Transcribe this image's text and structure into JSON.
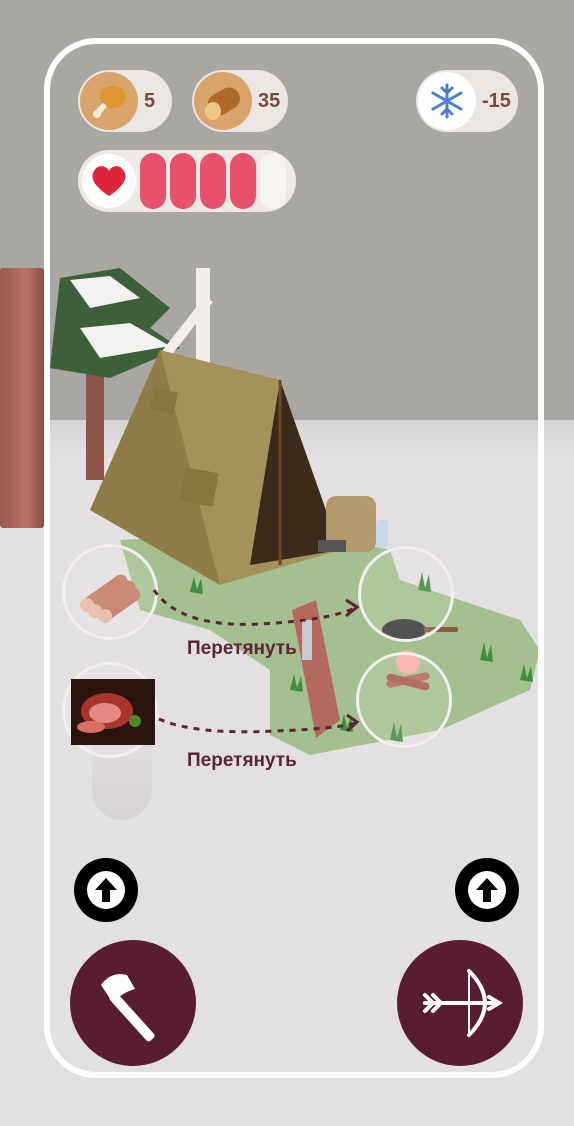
{
  "resources": {
    "food": {
      "icon": "drumstick-icon",
      "value": "5"
    },
    "wood": {
      "icon": "log-icon",
      "value": "35"
    },
    "temperature": {
      "icon": "snowflake-icon",
      "value": "-15"
    }
  },
  "health": {
    "icon": "heart-icon",
    "segments_total": 5,
    "segments_filled": 4,
    "color_on": "#e8506e"
  },
  "hints": {
    "logs": {
      "item_icon": "firewood-icon",
      "label": "Перетянуть",
      "target": "frying-pan"
    },
    "meat": {
      "item_icon": "ham-icon",
      "label": "Перетянуть",
      "target": "campfire"
    }
  },
  "controls": {
    "left_up": {
      "icon": "arrow-up-icon"
    },
    "right_up": {
      "icon": "arrow-up-icon"
    },
    "axe": {
      "icon": "axe-icon"
    },
    "bow": {
      "icon": "bow-icon"
    }
  },
  "colors": {
    "accent": "#581d31",
    "frame": "#ffffff",
    "grass": "#a5c08f"
  }
}
